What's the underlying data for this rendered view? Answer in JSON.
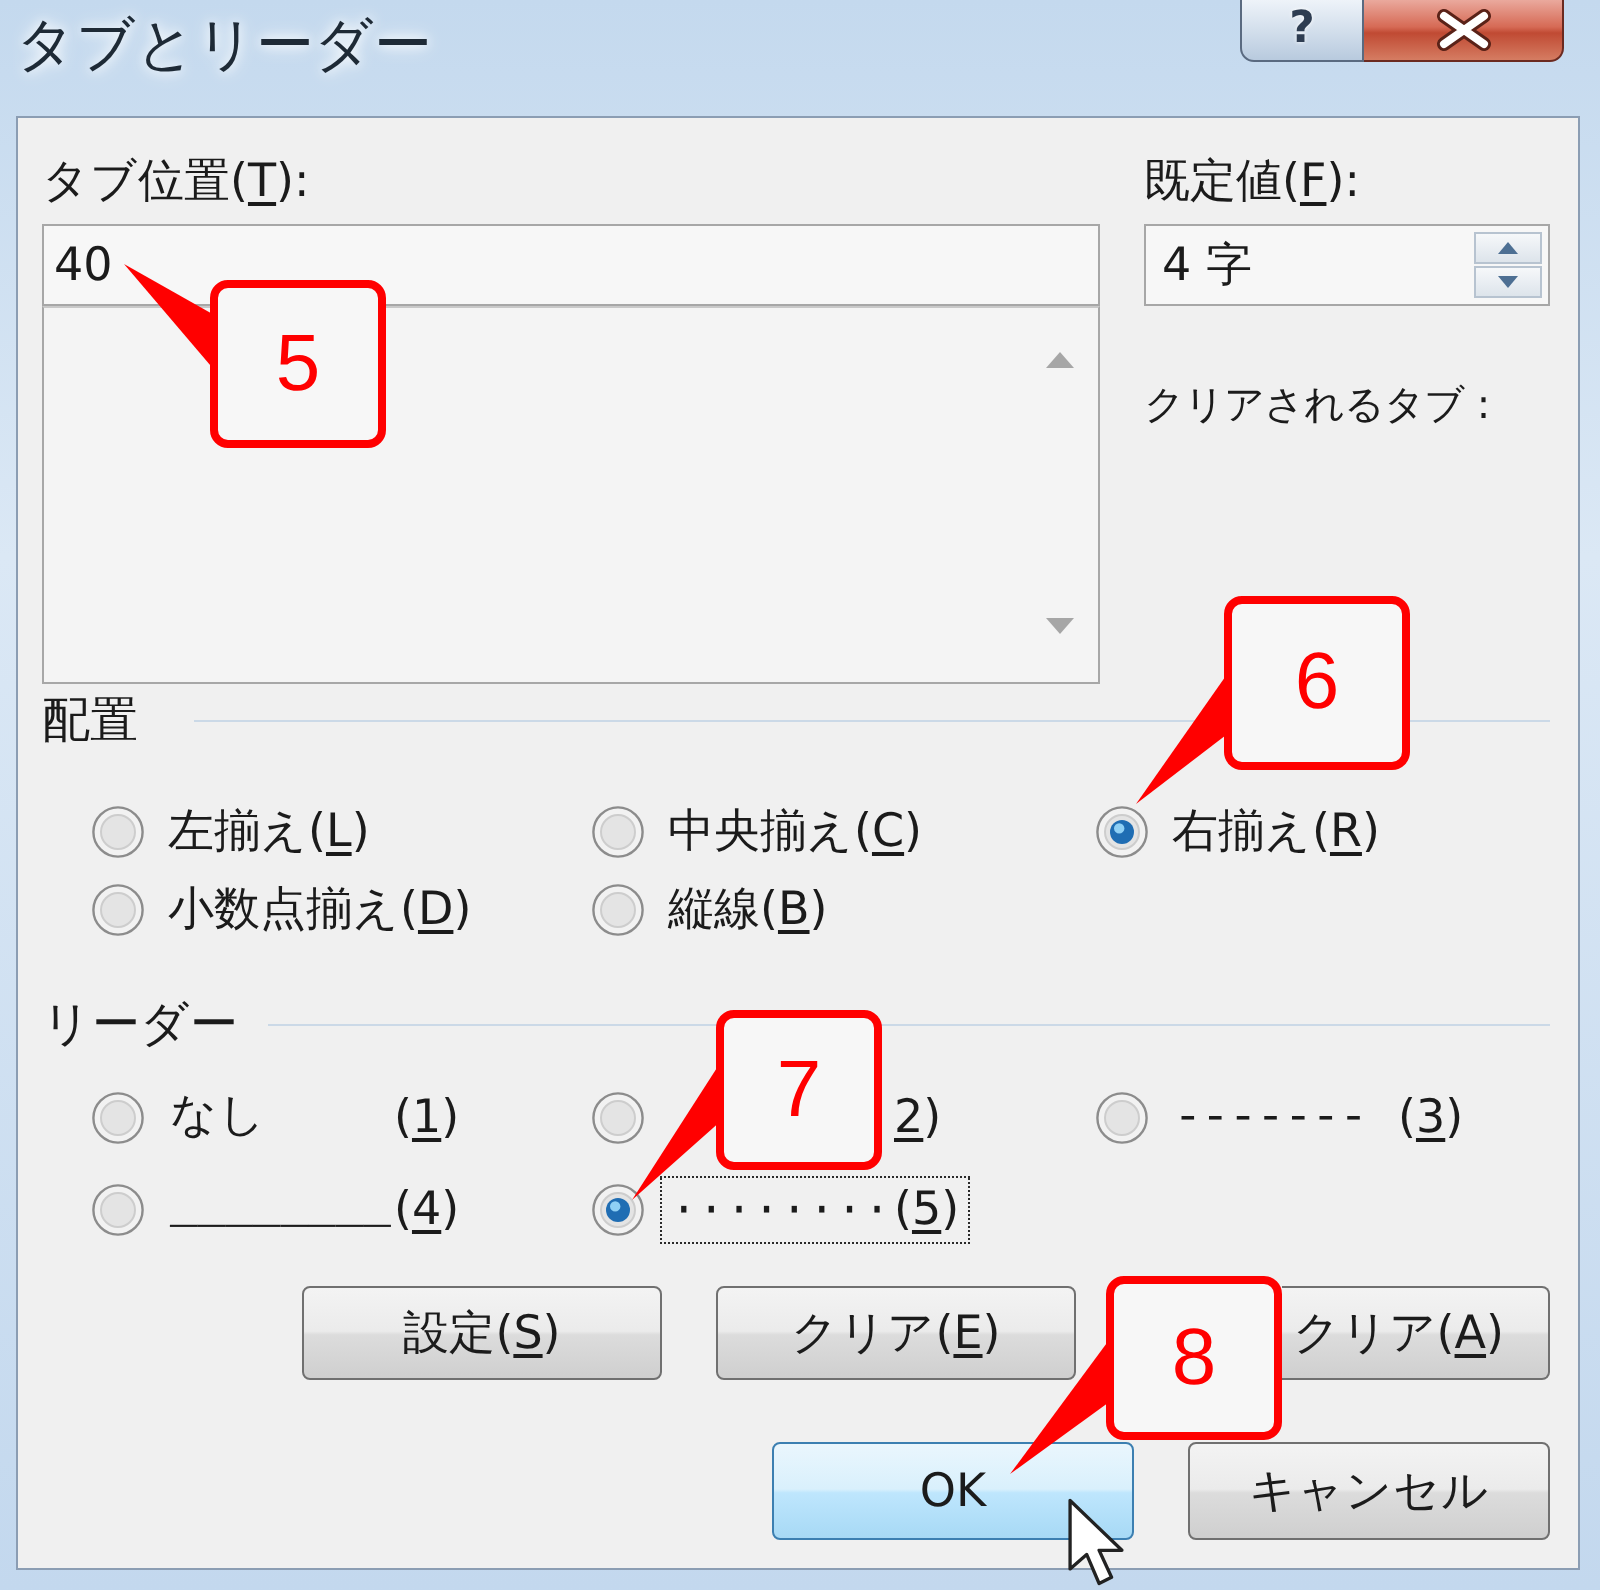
{
  "window": {
    "title": "タブとリーダー",
    "help_button": "?"
  },
  "tab_position": {
    "label": {
      "pre": "タブ位置(",
      "key": "T",
      "post": "):"
    },
    "value": "40"
  },
  "default_stops": {
    "label": {
      "pre": "既定値(",
      "key": "F",
      "post": "):"
    },
    "value": "4 字"
  },
  "tabs_to_clear": {
    "label": "クリアされるタブ :"
  },
  "alignment": {
    "title": "配置",
    "options": [
      {
        "label": {
          "pre": "左揃え(",
          "key": "L",
          "post": ")"
        },
        "selected": false
      },
      {
        "label": {
          "pre": "中央揃え(",
          "key": "C",
          "post": ")"
        },
        "selected": false
      },
      {
        "label": {
          "pre": "右揃え(",
          "key": "R",
          "post": ")"
        },
        "selected": true
      },
      {
        "label": {
          "pre": "小数点揃え(",
          "key": "D",
          "post": ")"
        },
        "selected": false
      },
      {
        "label": {
          "pre": "縦線(",
          "key": "B",
          "post": ")"
        },
        "selected": false
      }
    ]
  },
  "leader": {
    "title": "リーダー",
    "options": [
      {
        "sample": "なし",
        "label": {
          "pre": "(",
          "key": "1",
          "post": ")"
        },
        "selected": false,
        "focused": false
      },
      {
        "label": {
          "key": "2",
          "post": ")"
        },
        "selected": false,
        "focused": false
      },
      {
        "sample": "-------",
        "label": {
          "pre": "(",
          "key": "3",
          "post": ")"
        },
        "selected": false,
        "focused": false
      },
      {
        "sample": "________",
        "label": {
          "pre": "(",
          "key": "4",
          "post": ")"
        },
        "selected": false,
        "focused": false
      },
      {
        "sample": "········",
        "label": {
          "pre": "(",
          "key": "5",
          "post": ")"
        },
        "selected": true,
        "focused": true
      }
    ]
  },
  "action_buttons": [
    {
      "label": {
        "pre": "設定(",
        "key": "S",
        "post": ")"
      }
    },
    {
      "label": {
        "pre": "クリア(",
        "key": "E",
        "post": ")"
      }
    },
    {
      "label": {
        "pre": "クリア(",
        "key": "A",
        "post": ")"
      }
    }
  ],
  "dialog_buttons": [
    {
      "label": "OK",
      "highlighted": true
    },
    {
      "label": "キャンセル",
      "highlighted": false
    }
  ],
  "callouts": [
    {
      "number": "5"
    },
    {
      "number": "6"
    },
    {
      "number": "7"
    },
    {
      "number": "8"
    }
  ]
}
